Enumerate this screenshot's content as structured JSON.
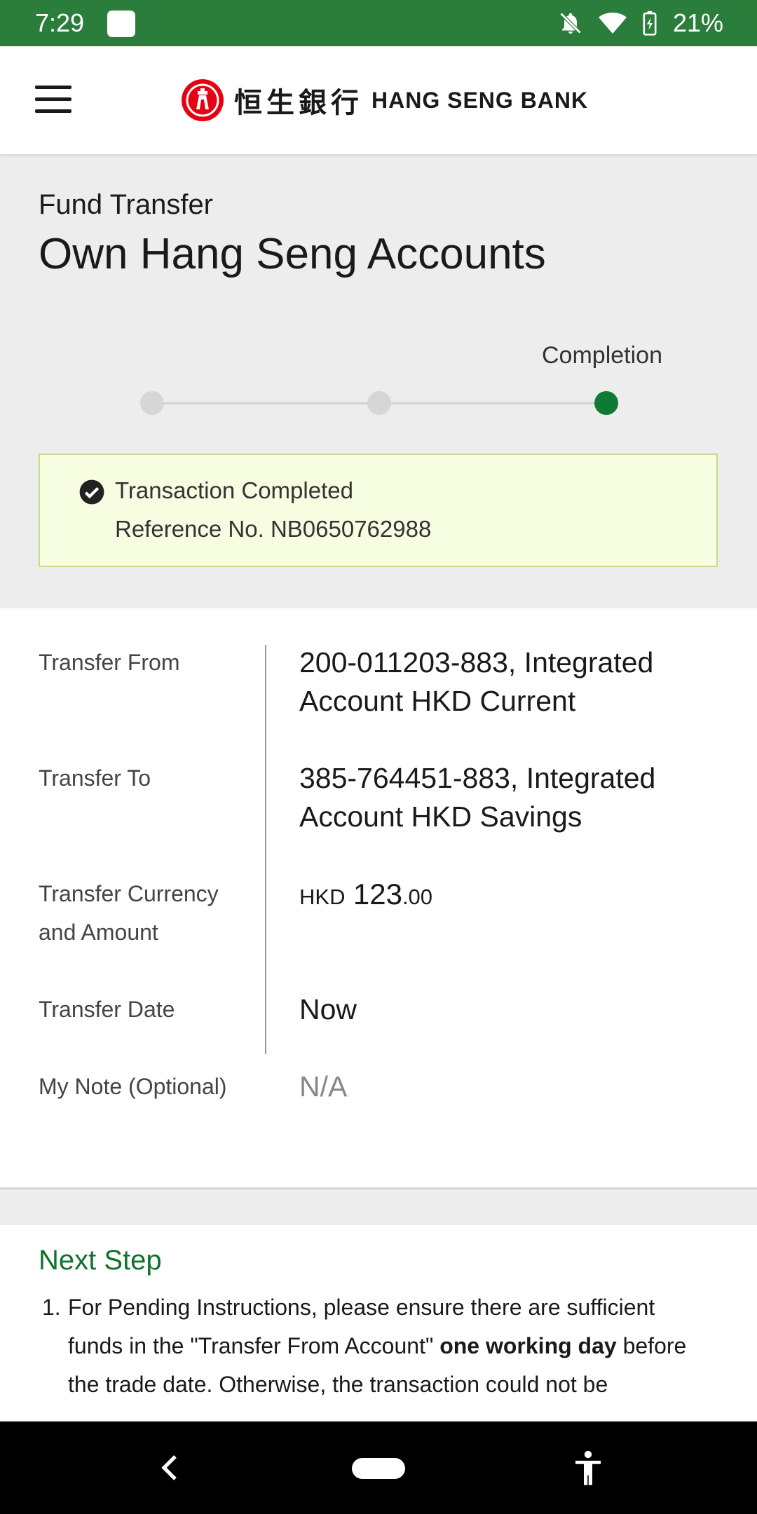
{
  "status_bar": {
    "time": "7:29",
    "battery": "21%",
    "icons": [
      "app-notification-icon",
      "bell-off-icon",
      "wifi-icon",
      "battery-charging-icon"
    ],
    "color": "#2a7d3a"
  },
  "header": {
    "logo_cn": "恒生銀行",
    "logo_en": "HANG SENG BANK",
    "menu_icon": "hamburger-menu-icon",
    "brand_color": "#e60012"
  },
  "page": {
    "subtitle": "Fund Transfer",
    "title": "Own Hang Seng Accounts"
  },
  "stepper": {
    "current_label": "Completion",
    "steps_total": 3,
    "current_step": 3,
    "active_color": "#0f7a33"
  },
  "result": {
    "status": "Transaction Completed",
    "reference": "Reference No. NB0650762988"
  },
  "details": [
    {
      "label": "Transfer From",
      "value": "200-011203-883, Integrated Account HKD Current"
    },
    {
      "label": "Transfer To",
      "value": "385-764451-883, Integrated Account HKD Savings"
    },
    {
      "label": "Transfer Currency and Amount",
      "currency": "HKD",
      "amount": "123",
      "decimals": ".00"
    },
    {
      "label": "Transfer Date",
      "value": "Now"
    },
    {
      "label": "My Note (Optional)",
      "value": "N/A"
    }
  ],
  "next_step": {
    "title": "Next Step",
    "items": [
      {
        "number": "1.",
        "text_before": "For Pending Instructions, please ensure there are sufficient funds in the \"Transfer From Account\" ",
        "text_bold": "one working day",
        "text_after": " before the trade date. Otherwise, the transaction could not be"
      }
    ]
  },
  "nav_bar": {
    "icons": [
      "back-icon",
      "home-pill-icon",
      "accessibility-icon"
    ]
  }
}
